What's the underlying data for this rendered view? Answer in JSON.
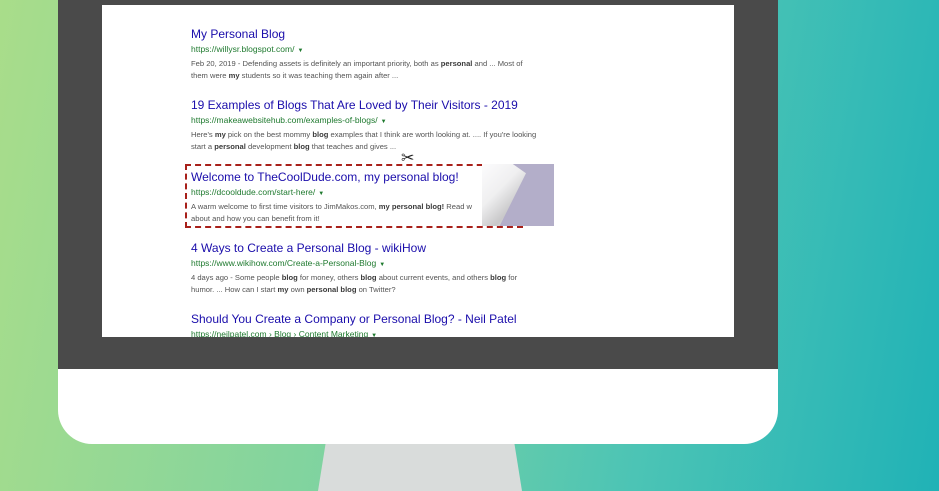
{
  "top_partial": "...",
  "results": [
    {
      "title": "My Personal Blog",
      "url": "https://willysr.blogspot.com/",
      "snippet_line1": [
        {
          "t": "Feb 20, 2019 - Defending assets is definitely an important priority, both as ",
          "b": false
        },
        {
          "t": "personal",
          "b": true
        },
        {
          "t": " and ... Most of",
          "b": false
        }
      ],
      "snippet_line2": [
        {
          "t": "them were ",
          "b": false
        },
        {
          "t": "my",
          "b": true
        },
        {
          "t": " students so it was teaching them again after ...",
          "b": false
        }
      ]
    },
    {
      "title": "19 Examples of Blogs That Are Loved by Their Visitors - 2019",
      "url": "https://makeawebsitehub.com/examples-of-blogs/",
      "snippet_line1": [
        {
          "t": "Here's ",
          "b": false
        },
        {
          "t": "my",
          "b": true
        },
        {
          "t": " pick on the best mommy ",
          "b": false
        },
        {
          "t": "blog",
          "b": true
        },
        {
          "t": " examples that I think are worth looking at. .... If you're looking",
          "b": false
        }
      ],
      "snippet_line2": [
        {
          "t": "start a ",
          "b": false
        },
        {
          "t": "personal",
          "b": true
        },
        {
          "t": " development ",
          "b": false
        },
        {
          "t": "blog",
          "b": true
        },
        {
          "t": " that teaches and gives ...",
          "b": false
        }
      ]
    },
    {
      "title": "Welcome to TheCoolDude.com, my personal blog!",
      "url": "https://dcooldude.com/start-here/",
      "snippet_line1": [
        {
          "t": "A warm welcome to first time visitors to JimMakos.com, ",
          "b": false
        },
        {
          "t": "my personal blog!",
          "b": true
        },
        {
          "t": " Read w",
          "b": false
        }
      ],
      "snippet_line2": [
        {
          "t": "about and how you can benefit from it!",
          "b": false
        }
      ]
    },
    {
      "title": "4 Ways to Create a Personal Blog - wikiHow",
      "url": "https://www.wikihow.com/Create-a-Personal-Blog",
      "snippet_line1": [
        {
          "t": "4 days ago",
          "b": false
        },
        {
          "t": " - Some people ",
          "b": false
        },
        {
          "t": "blog",
          "b": true
        },
        {
          "t": " for money, others ",
          "b": false
        },
        {
          "t": "blog",
          "b": true
        },
        {
          "t": " about current events, and others ",
          "b": false
        },
        {
          "t": "blog",
          "b": true
        },
        {
          "t": " for",
          "b": false
        }
      ],
      "snippet_line2": [
        {
          "t": "humor. ... How can I start ",
          "b": false
        },
        {
          "t": "my",
          "b": true
        },
        {
          "t": " own ",
          "b": false
        },
        {
          "t": "personal blog",
          "b": true
        },
        {
          "t": " on Twitter?",
          "b": false
        }
      ]
    },
    {
      "title": "Should You Create a Company or Personal Blog? - Neil Patel",
      "url": "https://neilpatel.com › Blog › Content Marketing",
      "snippet_line1": [],
      "snippet_line2": []
    }
  ],
  "icons": {
    "scissors": "✂",
    "caret": "▼"
  },
  "colors": {
    "link": "#1a0dab",
    "url": "#1f7a2f",
    "cut_line": "#a8201a",
    "peel": "#b3aec9",
    "bezel": "#4a4a4a"
  }
}
